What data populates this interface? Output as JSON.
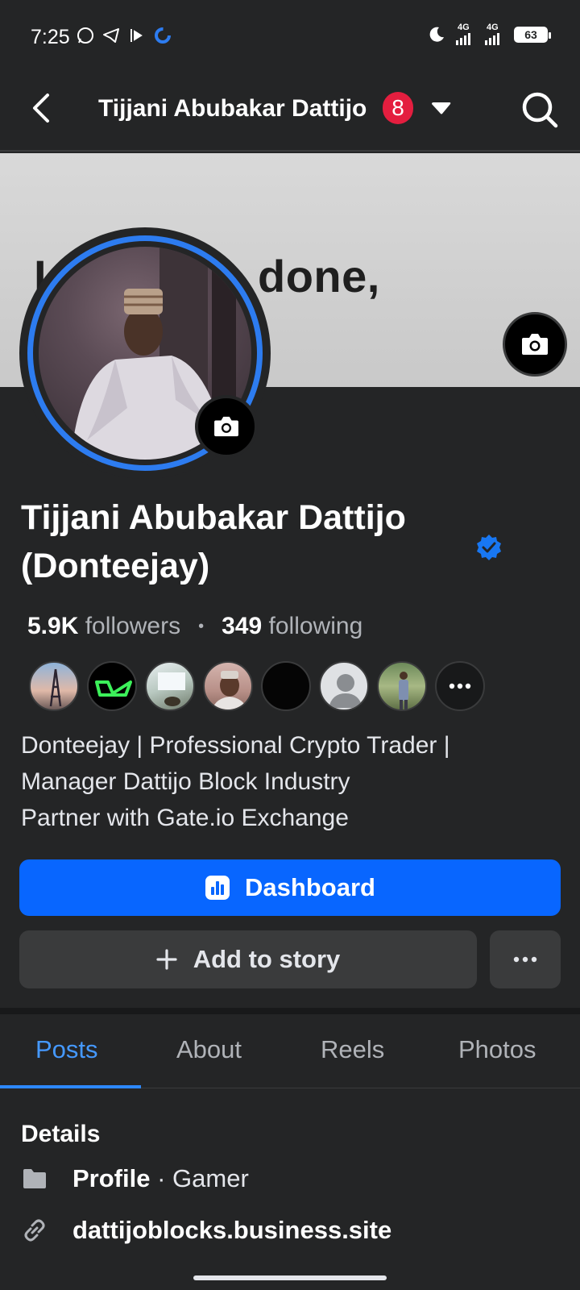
{
  "status_bar": {
    "time": "7:25",
    "network_1": "4G",
    "network_2": "4G",
    "battery": "63"
  },
  "header": {
    "title": "Tijjani Abubakar Dattijo",
    "notification_count": "8",
    "icons": {
      "back": "back-arrow-icon",
      "dropdown": "caret-down-icon",
      "search": "search-icon"
    }
  },
  "cover": {
    "visible_text": "done,",
    "partial_text": "I"
  },
  "profile": {
    "name_line1": "Tijjani Abubakar Dattijo",
    "name_line2": "(Donteejay)",
    "verified": true,
    "followers_count": "5.9K",
    "followers_label": "followers",
    "following_count": "349",
    "following_label": "following",
    "separator": "•",
    "bio": [
      "Donteejay | Professional Crypto Trader |",
      "Manager Dattijo Block Industry",
      "Partner with Gate.io Exchange"
    ]
  },
  "actions": {
    "dashboard_label": "Dashboard",
    "add_story_label": "Add to story",
    "more_label": "···"
  },
  "tabs": [
    {
      "label": "Posts",
      "active": true
    },
    {
      "label": "About",
      "active": false
    },
    {
      "label": "Reels",
      "active": false
    },
    {
      "label": "Photos",
      "active": false
    }
  ],
  "details": {
    "title": "Details",
    "profile_label": "Profile",
    "profile_value": "· Gamer",
    "website": "dattijoblocks.business.site"
  },
  "colors": {
    "background": "#242526",
    "accent_blue": "#0866ff",
    "tab_active": "#4599ff",
    "badge_red": "#e41e3f"
  }
}
